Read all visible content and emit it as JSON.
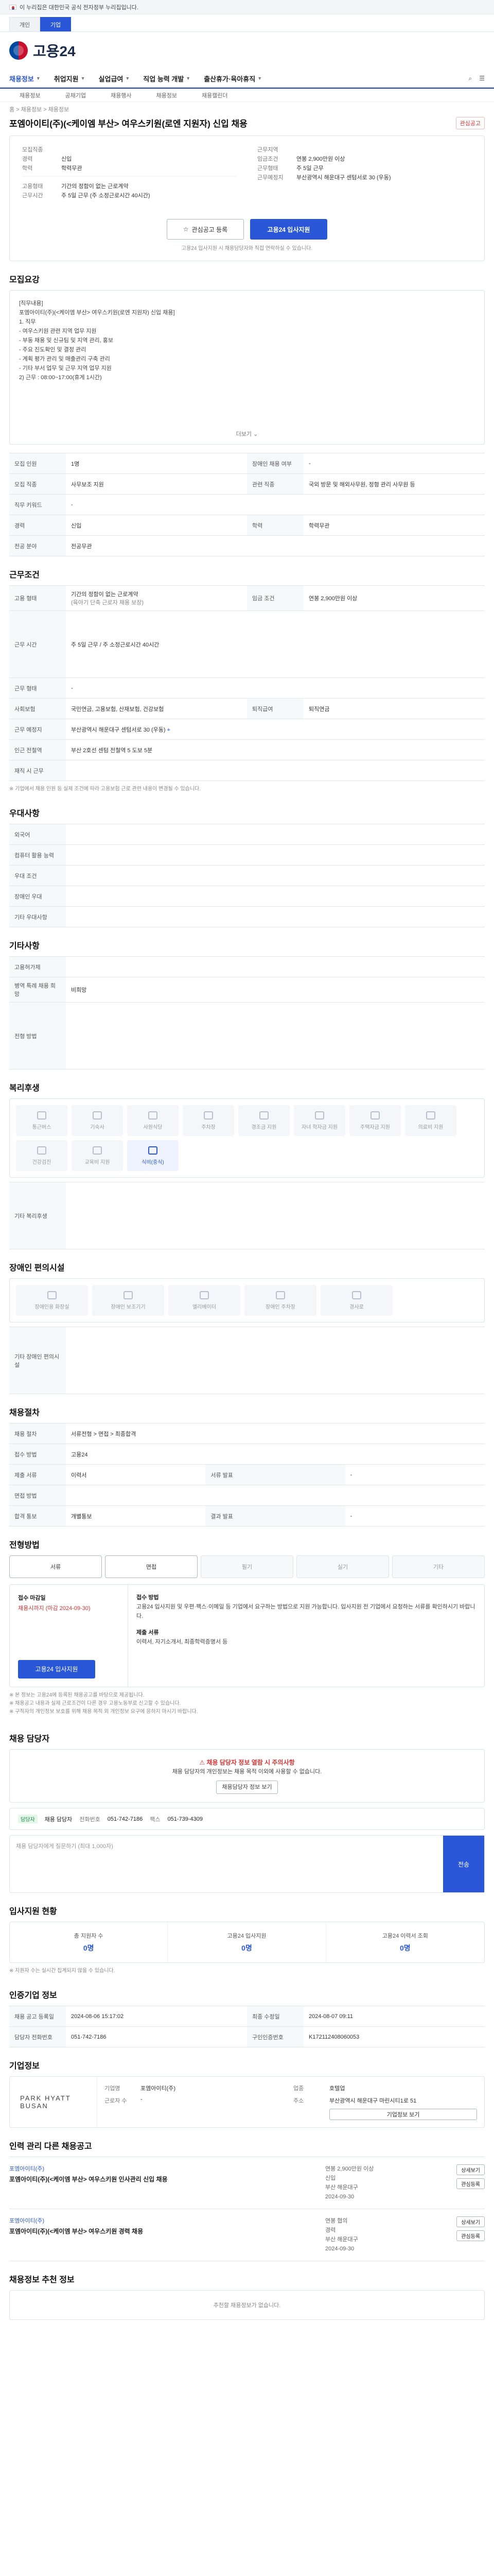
{
  "gov_bar": {
    "text": "이 누리집은 대한민국 공식 전자정부 누리집입니다."
  },
  "top_tabs": [
    {
      "label": "개인"
    },
    {
      "label": "기업"
    }
  ],
  "logo": {
    "text": "고용24"
  },
  "gnb": {
    "items": [
      {
        "label": "채용정보"
      },
      {
        "label": "취업지원"
      },
      {
        "label": "실업급여"
      },
      {
        "label": "직업 능력 개발"
      },
      {
        "label": "출산휴가·육아휴직"
      }
    ]
  },
  "subnav": [
    "채용정보",
    "공채기업",
    "채용행사",
    "채용정보",
    "채용캘린더"
  ],
  "breadcrumb": "홈 > 채용정보 > 채용정보",
  "job": {
    "title": "포엠아이티(주)(<케이엠 부산> 여우스키원(로엔 지원자) 신입 채용",
    "fav_label": "관심공고"
  },
  "summary": {
    "company_label": "모집직종",
    "company_value": "",
    "career_label": "경력",
    "career_value": "신입",
    "edu_label": "학력",
    "edu_value": "학력무관",
    "region_label": "근무지역",
    "region_value": "",
    "emp_label": "고용형태",
    "emp_value": "",
    "work_label": "근무시간",
    "work_value": "",
    "pay_label": "임금조건",
    "pay_value": "연봉 2,900만원 이상",
    "time_label": "근무형태",
    "time_value": "주 5일 근무",
    "addr_label": "근무예정지",
    "addr_value": "부산광역시 해운대구 센텀서로 30 (우동)",
    "kind_label": "고용형태",
    "kind_value": "기간의 정함이 없는 근로계약",
    "hours_label": "근무시간",
    "hours_value": "주 5일 근무 (주 소정근로시간 40시간)"
  },
  "actions": {
    "save": "관심공고 등록",
    "apply": "고용24 입사지원"
  },
  "notice": "고용24 입사지원 시 채용담당자와 직접 연락하실 수 있습니다.",
  "sections": {
    "recruit": "모집요강",
    "conditions": "근무조건",
    "welfare": "우대사항",
    "other": "기타사항",
    "benefits": "복리후생",
    "disability": "장애인 편의시설",
    "process": "채용절차",
    "apply_method": "전형방법",
    "contact": "채용 담당자",
    "stats": "입사지원 현황",
    "info": "인증기업 정보",
    "company": "기업정보",
    "related": "인력 관리 다른 채용공고",
    "recommend": "채용정보 추천 정보"
  },
  "recruit_desc": {
    "lines": [
      "[직무내용]",
      "포엠아이티(주)(<케이엠 부산> 여우스키원(로엔 지원자) 신입 채용]",
      "1. 직무",
      " - 여우스키원 관련 지역 업무 지원",
      " - 부동 채용 및 신규팀 및 지역 관리, 홍보",
      " - 주요 진도확인 및 결정 관리",
      " - 계획 평가 관리 및 매출관리 구축 관리",
      " - 기타 부서 업무 및 근무 지역 업무 지원",
      "2) 근무 : 08:00~17:00(휴게 1시간)"
    ],
    "more": "더보기"
  },
  "recruit_table": [
    {
      "k": "모집 인원",
      "v": "1명",
      "k2": "장애인 채용 여부",
      "v2": "-"
    },
    {
      "k": "모집 직종",
      "v": "사무보조 지원",
      "k2": "관련 직종",
      "v2": "국외 방문 및 해외사무원, 정형 관리 사무원 등"
    },
    {
      "k": "직무 키워드",
      "v": "-",
      "k2": "",
      "v2": ""
    },
    {
      "k": "경력",
      "v": "신입",
      "k2": "학력",
      "v2": "학력무관"
    },
    {
      "k": "전공 분야",
      "v": "전공무관",
      "k2": "",
      "v2": ""
    }
  ],
  "cond_table": {
    "emp_k": "고용 형태",
    "emp_v": "기간의 정함이 없는 근로계약",
    "emp_note": "(육아기 단축 근로자 채용 보장)",
    "pay_k": "임금 조건",
    "pay_v": "연봉 2,900만원 이상",
    "time_k": "근무 시간",
    "time_v": "주 5일 근무 / 주 소정근로시간 40시간",
    "shift_k": "근무 형태",
    "shift_v": "-",
    "insurance_k": "사회보험",
    "insurance_v": "국민연금, 고용보험, 산재보험, 건강보험",
    "retire_k": "퇴직급여",
    "retire_v": "퇴직연금",
    "loc_k": "근무 예정지",
    "loc_v": "부산광역시 해운대구 센텀서로 30 (우동)",
    "near_k": "인근 전철역",
    "near_v": "부산 2호선 센텀 전철역 5 도보 5분",
    "car_k": "재직 시 근무",
    "car_v": "",
    "note": "※ 기업에서 채용 인원 등 실제 조건에 따라 고용보험 근로 관련 내용이 변경될 수 있습니다."
  },
  "welfare_table": [
    {
      "k": "외국어",
      "v": ""
    },
    {
      "k": "컴퓨터 활용 능력",
      "v": ""
    },
    {
      "k": "우대 조건",
      "v": ""
    },
    {
      "k": "장애인 우대",
      "v": ""
    },
    {
      "k": "기타 우대사항",
      "v": ""
    }
  ],
  "other_table": [
    {
      "k": "고용허가제",
      "v": ""
    },
    {
      "k": "병역 특례 채용 희망",
      "v": "비희망"
    },
    {
      "k": "전형 방법",
      "v": ""
    },
    {
      "k": "기타 복리후생",
      "v": ""
    }
  ],
  "benefit_icons": [
    "통근버스",
    "기숙사",
    "사원식당",
    "주차장",
    "경조금 지원",
    "자녀 학자금 지원",
    "주택자금 지원",
    "의료비 지원",
    "건강검진",
    "교육비 지원",
    "식비(중식)"
  ],
  "benefit_other_k": "기타 복리후생",
  "disability_icons": [
    "장애인용 화장실",
    "장애인 보조기기",
    "엘리베이터",
    "장애인 주차장",
    "경사로",
    "기타 편의시설"
  ],
  "disability_other_k": "기타 장애인 편의시설",
  "process_table": [
    {
      "k": "채용 절차",
      "v": "서류전형 > 면접 > 최종합격"
    },
    {
      "k": "접수 방법",
      "v": "고용24"
    },
    {
      "k": "제출 서류",
      "v": "이력서",
      "k2": "서류 발표",
      "v2": "-"
    },
    {
      "k": "면접 방법",
      "v": ""
    },
    {
      "k": "합격 통보",
      "v": "개별통보",
      "k2": "결과 발표",
      "v2": "-"
    }
  ],
  "apply_steps": [
    "서류",
    "면접",
    "필기",
    "실기",
    "기타"
  ],
  "apply": {
    "label_deadline": "접수 마감일",
    "deadline": "채용시까지 (마감 2024-09-30)",
    "label_method": "접수 방법",
    "method_desc": "고용24 입사지원 및 우편·팩스·이메일 등 기업에서 요구하는 방법으로 지원 가능합니다. 입사지원 전 기업에서 요청하는 서류를 확인하시기 바랍니다.",
    "docs_label": "제출 서류",
    "docs": "이력서, 자기소개서, 최종학력증명서 등",
    "btn": "고용24 입사지원"
  },
  "legal_notes": [
    "※ 본 정보는 고용24에 등록된 채용공고를 바탕으로 제공됩니다.",
    "※ 채용공고 내용과 실제 근로조건이 다른 경우 고용노동부로 신고할 수 있습니다.",
    "※ 구직자의 개인정보 보호를 위해 채용 목적 외 개인정보 요구에 응하지 마시기 바랍니다."
  ],
  "contact": {
    "warn": "채용 담당자 정보 열람 시 주의사항",
    "desc": "채용 담당자의 개인정보는 채용 목적 이외에 사용할 수 없습니다.",
    "btn": "채용담당자 정보 보기",
    "tag": "담당자",
    "name": "채용 담당자",
    "tel_label": "전화번호",
    "tel": "051-742-7186",
    "fax_label": "팩스",
    "fax": "051-739-4309",
    "q_placeholder": "채용 담당자에게 질문하기 (최대 1,000자)",
    "q_btn": "전송"
  },
  "stats": [
    {
      "label": "총 지원자 수",
      "value": "0명"
    },
    {
      "label": "고용24 입사지원",
      "value": "0명"
    },
    {
      "label": "고용24 이력서 조회",
      "value": "0명"
    }
  ],
  "stats_note": "※ 지원자 수는 실시간 집계되지 않을 수 있습니다.",
  "info_table": {
    "reg_k": "채용 공고 등록일",
    "reg_v": "2024-08-06 15:17:02",
    "mod_k": "최종 수정일",
    "mod_v": "2024-08-07 09:11",
    "tel_k": "담당자 전화번호",
    "tel_v": "051-742-7186",
    "num_k": "구인인증번호",
    "num_v": "K172112408060053"
  },
  "company": {
    "logo_text": "PARK HYATT BUSAN",
    "name_k": "기업명",
    "name_v": "포엠아이티(주)",
    "biz_k": "업종",
    "biz_v": "호텔업",
    "emp_k": "근로자 수",
    "emp_v": "-",
    "addr_k": "주소",
    "addr_v": "부산광역시 해운대구 마린시티1로 51",
    "btn": "기업정보 보기"
  },
  "related_jobs": [
    {
      "company": "포엠아이티(주)",
      "title": "포엠아이티(주)(<케이엠 부산> 여우스키원 인사관리 신입 채용",
      "pay": "연봉 2,900만원 이상",
      "career": "신입",
      "region": "부산 해운대구",
      "deadline": "2024-09-30"
    },
    {
      "company": "포엠아이티(주)",
      "title": "포엠아이티(주)(<케이엠 부산> 여우스키원 경력 채용",
      "pay": "연봉 협의",
      "career": "경력",
      "region": "부산 해운대구",
      "deadline": "2024-09-30"
    }
  ],
  "related_btns": {
    "detail": "상세보기",
    "save": "관심등록"
  },
  "recommend_empty": "추천할 채용정보가 없습니다."
}
